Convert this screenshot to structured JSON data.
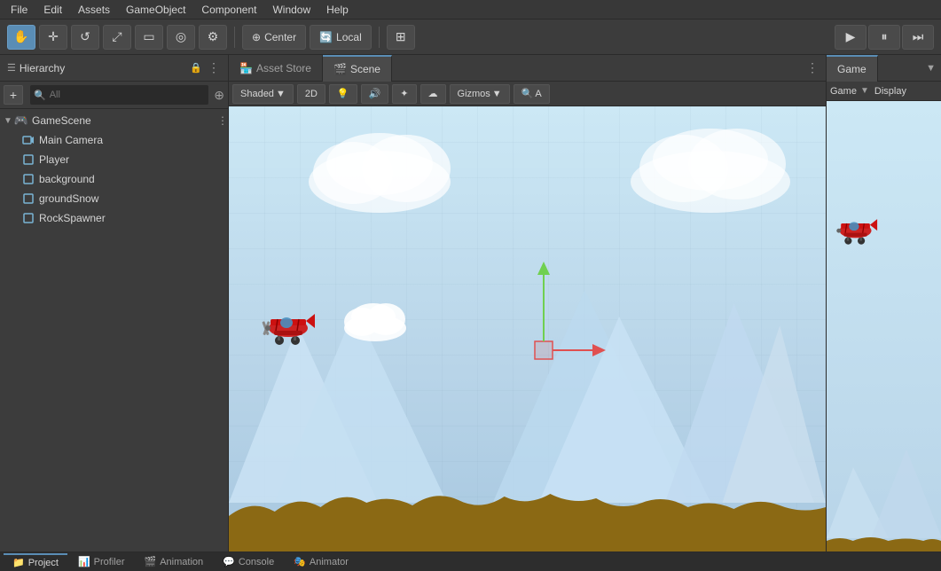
{
  "menu": {
    "items": [
      "File",
      "Edit",
      "Assets",
      "GameObject",
      "Component",
      "Window",
      "Help"
    ]
  },
  "toolbar": {
    "tools": [
      "✋",
      "✛",
      "↺",
      "⤢",
      "▭",
      "◎",
      "⚙"
    ],
    "center_label": "Center",
    "local_label": "Local",
    "grid_icon": "⊞",
    "play_label": "▶",
    "pause_label": "⏸",
    "step_label": "⏭"
  },
  "hierarchy": {
    "title": "Hierarchy",
    "search_placeholder": "All",
    "scene_name": "GameScene",
    "items": [
      {
        "label": "Main Camera",
        "icon": "cam"
      },
      {
        "label": "Player",
        "icon": "obj"
      },
      {
        "label": "background",
        "icon": "obj"
      },
      {
        "label": "groundSnow",
        "icon": "obj"
      },
      {
        "label": "RockSpawner",
        "icon": "obj"
      }
    ]
  },
  "asset_store": {
    "tab_label": "Asset Store"
  },
  "scene": {
    "tab_label": "Scene",
    "shading_label": "Shaded",
    "2d_label": "2D",
    "gizmos_label": "Gizmos"
  },
  "game": {
    "tab_label": "Game",
    "display_label": "Display",
    "game_label": "Game"
  },
  "bottom_tabs": [
    {
      "label": "Project",
      "icon": "📁"
    },
    {
      "label": "Profiler",
      "icon": "📊"
    },
    {
      "label": "Animation",
      "icon": "🎬"
    },
    {
      "label": "Console",
      "icon": "💬"
    },
    {
      "label": "Animator",
      "icon": "🎭"
    }
  ]
}
